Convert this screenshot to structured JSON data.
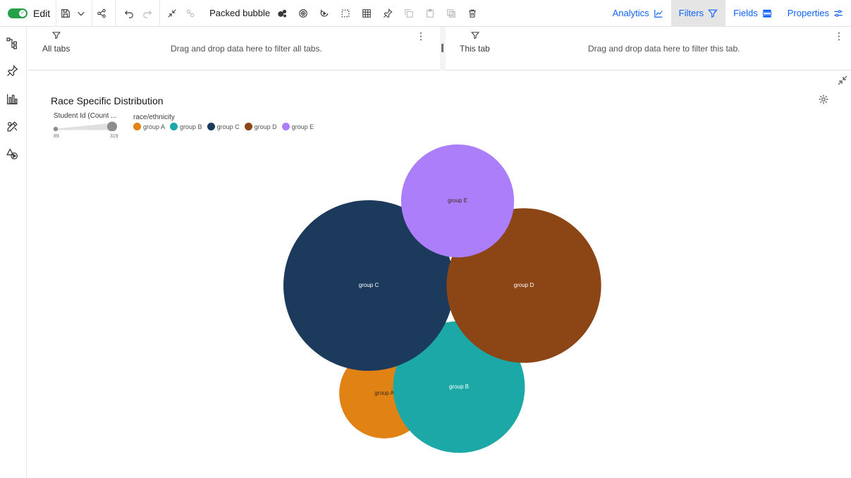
{
  "toolbar": {
    "edit_label": "Edit",
    "viz_label": "Packed bubble",
    "tabs": [
      {
        "label": "Analytics",
        "icon": "analytics-icon"
      },
      {
        "label": "Filters",
        "icon": "filter-icon",
        "active": true
      },
      {
        "label": "Fields",
        "icon": "fields-icon"
      },
      {
        "label": "Properties",
        "icon": "properties-icon"
      }
    ]
  },
  "filters": {
    "all_tabs": {
      "name": "All tabs",
      "hint": "Drag and drop data here to filter all tabs."
    },
    "this_tab": {
      "name": "This tab",
      "hint": "Drag and drop data here to filter this tab."
    }
  },
  "colors": {
    "accent": "#0f62fe",
    "toggle_on": "#24a148"
  },
  "chart_data": {
    "type": "packed-bubble",
    "title": "Race Specific Distribution",
    "size_legend": {
      "title": "Student Id (Count ...",
      "min": 89,
      "max": 319
    },
    "color_legend": {
      "title": "race/ethnicity"
    },
    "series": [
      {
        "name": "group A",
        "value": 89,
        "color": "#e08214"
      },
      {
        "name": "group B",
        "value": 190,
        "color": "#1ba8a6"
      },
      {
        "name": "group C",
        "value": 319,
        "color": "#1b3a5c"
      },
      {
        "name": "group D",
        "value": 262,
        "color": "#8c4515"
      },
      {
        "name": "group E",
        "value": 140,
        "color": "#ac7efa"
      }
    ]
  }
}
